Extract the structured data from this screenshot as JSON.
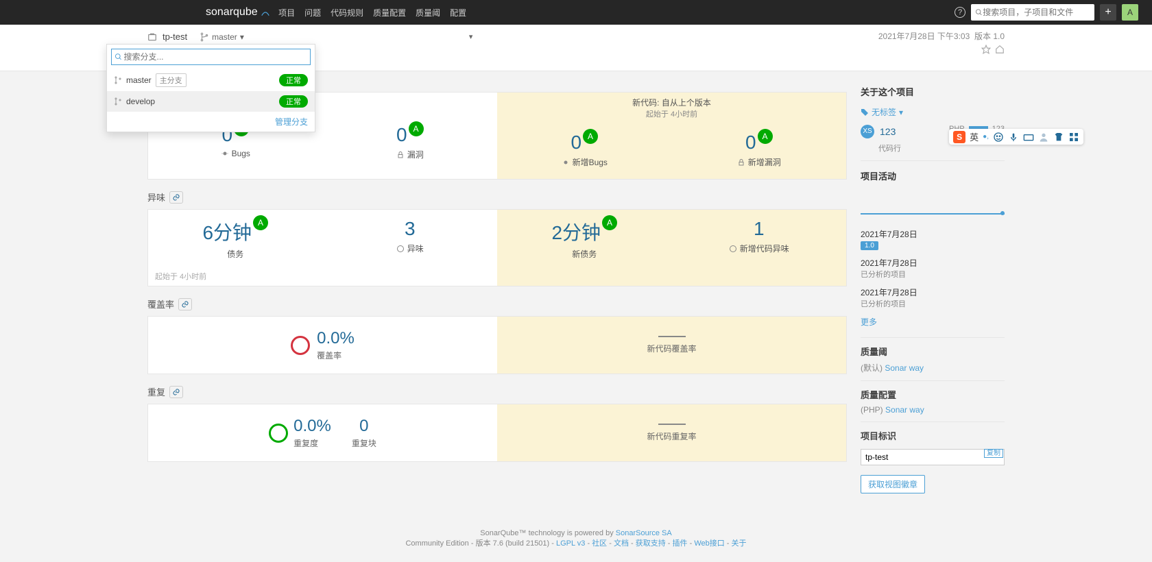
{
  "nav": {
    "logo1": "sonar",
    "logo2": "qube",
    "links": [
      "项目",
      "问题",
      "代码规则",
      "质量配置",
      "质量阈",
      "配置"
    ],
    "search_ph": "搜索项目，子项目和文件",
    "avatar": "A"
  },
  "project": {
    "name": "tp-test",
    "branch": "master",
    "date": "2021年7月28日 下午3:03",
    "version_lbl": "版本",
    "version": "1.0"
  },
  "dropdown": {
    "search_ph": "搜索分支...",
    "items": [
      {
        "name": "master",
        "badge": "主分支",
        "status": "正常"
      },
      {
        "name": "develop",
        "badge": "",
        "status": "正常"
      }
    ],
    "footer": "管理分支"
  },
  "extra_chev": "▾",
  "new_code": {
    "title": "新代码: 自从上个版本",
    "sub": "起始于 4小时前"
  },
  "overview": {
    "bugs": {
      "v": "0",
      "r": "A",
      "l": "Bugs"
    },
    "vuln": {
      "v": "0",
      "r": "A",
      "l": "漏洞"
    },
    "new_bugs": {
      "v": "0",
      "r": "A",
      "l": "新增Bugs"
    },
    "new_vuln": {
      "v": "0",
      "r": "A",
      "l": "新增漏洞"
    }
  },
  "smell_title": "异味",
  "smell": {
    "debt": {
      "v": "6分钟",
      "r": "A",
      "l": "债务"
    },
    "smells": {
      "v": "3",
      "l": "异味"
    },
    "new_debt": {
      "v": "2分钟",
      "r": "A",
      "l": "新债务"
    },
    "new_smells": {
      "v": "1",
      "l": "新增代码异味"
    },
    "since": "起始于 4小时前"
  },
  "cov_title": "覆盖率",
  "cov": {
    "pct": "0.0%",
    "lbl": "覆盖率",
    "new_lbl": "新代码覆盖率"
  },
  "dup_title": "重复",
  "dup": {
    "pct": "0.0%",
    "lbl": "重复度",
    "blocks": "0",
    "blocks_lbl": "重复块",
    "new_lbl": "新代码重复率"
  },
  "sidebar": {
    "about": "关于这个项目",
    "no_tags": "无标签",
    "xs": "XS",
    "loc": "123",
    "loc_lbl": "代码行",
    "lang": "PHP",
    "lang_loc": "123",
    "activity": "项目活动",
    "acts": [
      {
        "date": "2021年7月28日",
        "sub": "",
        "badge": "1.0"
      },
      {
        "date": "2021年7月28日",
        "sub": "已分析的项目",
        "badge": ""
      },
      {
        "date": "2021年7月28日",
        "sub": "已分析的项目",
        "badge": ""
      }
    ],
    "more": "更多",
    "qg": "质量阈",
    "qg_def": "(默认)",
    "qg_link": "Sonar way",
    "qp": "质量配置",
    "qp_lang": "(PHP)",
    "qp_link": "Sonar way",
    "key_lbl": "项目标识",
    "key": "tp-test",
    "copy": "复制",
    "badge_btn": "获取视图徽章"
  },
  "footer": {
    "l1_a": "SonarQube™ technology is powered by ",
    "l1_b": "SonarSource SA",
    "edition": "Community Edition",
    "ver": "版本 7.6 (build 21501)",
    "lgpl": "LGPL v3",
    "links": [
      "社区",
      "文档",
      "获取支持",
      "插件",
      "Web接口",
      "关于"
    ]
  },
  "ime": {
    "lang": "英"
  }
}
